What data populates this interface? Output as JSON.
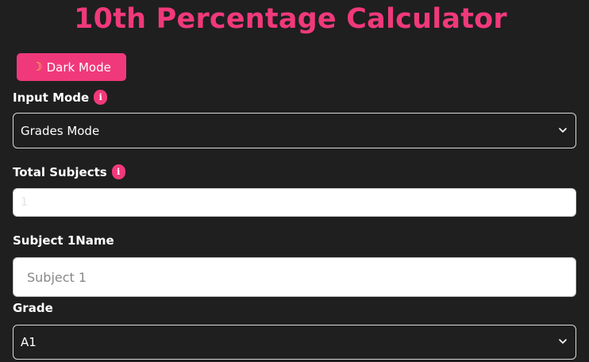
{
  "page": {
    "title": "10th Percentage Calculator"
  },
  "theme_toggle": {
    "icon": "crescent-moon-icon",
    "label": "Dark Mode"
  },
  "input_mode": {
    "label": "Input Mode",
    "info": "i",
    "selected": "Grades Mode"
  },
  "total_subjects": {
    "label": "Total Subjects",
    "info": "i",
    "placeholder": "1"
  },
  "subject_1": {
    "name_label": "Subject 1Name",
    "name_placeholder": "Subject 1",
    "grade_label": "Grade",
    "grade_selected": "A1"
  },
  "colors": {
    "accent": "#f0397a",
    "background": "#1f1f1f"
  }
}
